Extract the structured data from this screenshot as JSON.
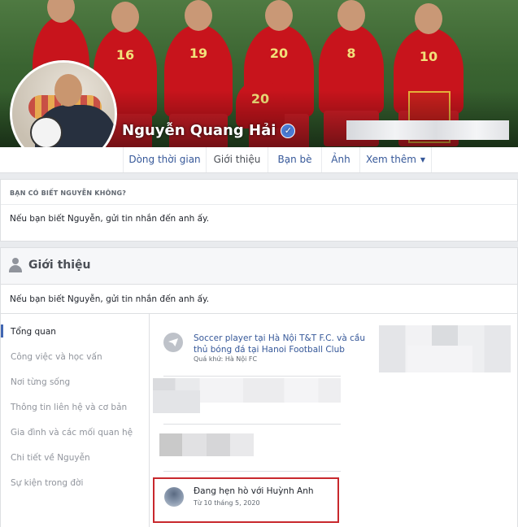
{
  "profile": {
    "name": "Nguyễn Quang Hải",
    "verified_glyph": "✓"
  },
  "cover": {
    "jersey_numbers": [
      "16",
      "19",
      "20",
      "8",
      "10",
      "20"
    ]
  },
  "tabs": [
    {
      "label": "Dòng thời gian"
    },
    {
      "label": "Giới thiệu",
      "active": true
    },
    {
      "label": "Bạn bè"
    },
    {
      "label": "Ảnh"
    },
    {
      "label": "Xem thêm",
      "caret": "▼"
    }
  ],
  "know_card": {
    "header": "BẠN CÓ BIẾT NGUYỄN KHÔNG?",
    "message": "Nếu bạn biết Nguyễn, gửi tin nhắn đến anh ấy."
  },
  "intro": {
    "title": "Giới thiệu",
    "message": "Nếu bạn biết Nguyễn, gửi tin nhắn đến anh ấy.",
    "nav": [
      {
        "label": "Tổng quan",
        "active": true
      },
      {
        "label": "Công việc và học vấn"
      },
      {
        "label": "Nơi từng sống"
      },
      {
        "label": "Thông tin liên hệ và cơ bản"
      },
      {
        "label": "Gia đình và các mối quan hệ"
      },
      {
        "label": "Chi tiết về Nguyễn"
      },
      {
        "label": "Sự kiện trong đời"
      }
    ],
    "work": {
      "title": "Soccer player tại Hà Nội T&T F.C. và cầu thủ bóng đá tại Hanoi Football Club",
      "sub": "Quá khứ: Hà Nội FC"
    },
    "relationship": {
      "title": "Đang hẹn hò với Huỳnh Anh",
      "sub": "Từ 10 tháng 5, 2020"
    }
  },
  "colors": {
    "link": "#365899",
    "highlight_border": "#c8282d",
    "jersey": "#c8141c"
  }
}
